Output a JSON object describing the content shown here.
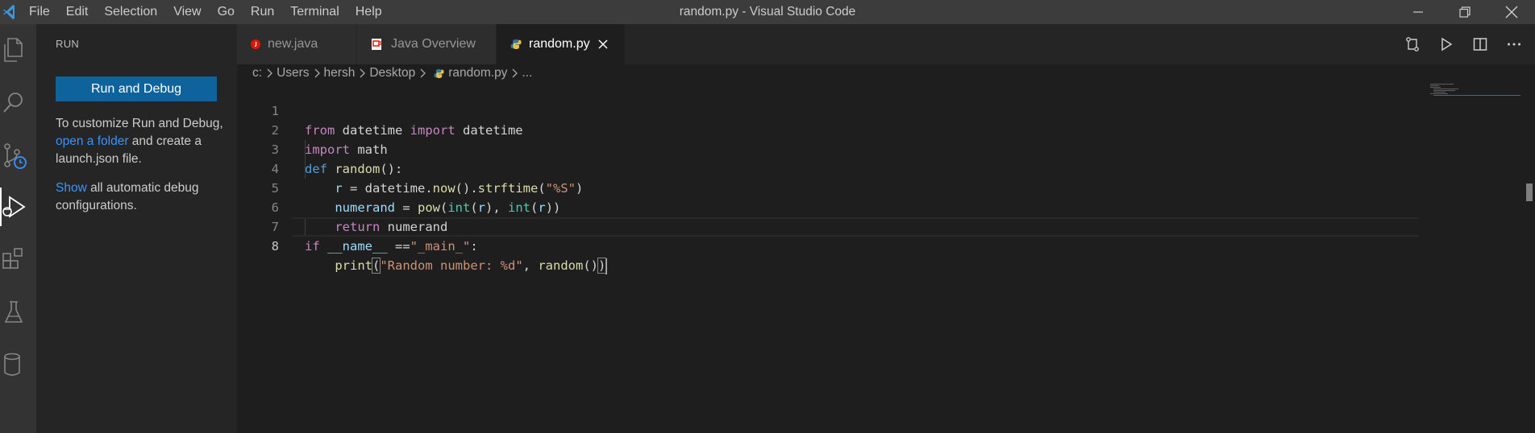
{
  "window": {
    "title": "random.py - Visual Studio Code",
    "menu": [
      "File",
      "Edit",
      "Selection",
      "View",
      "Go",
      "Run",
      "Terminal",
      "Help"
    ]
  },
  "activity_bar": {
    "items": [
      "explorer-icon",
      "search-icon",
      "source-control-icon",
      "run-debug-icon",
      "extensions-icon",
      "testing-icon",
      "database-icon"
    ],
    "active": "run-debug-icon"
  },
  "sidebar": {
    "title": "RUN",
    "run_button": "Run and Debug",
    "para1_prefix": "To customize Run and Debug, ",
    "para1_link": "open a folder",
    "para1_suffix": " and create a launch.json file.",
    "para2_link": "Show",
    "para2_suffix": " all automatic debug configurations."
  },
  "tabs": [
    {
      "label": "new.java",
      "icon": "java-error-icon",
      "active": false
    },
    {
      "label": "Java Overview",
      "icon": "java-overview-icon",
      "active": false
    },
    {
      "label": "random.py",
      "icon": "python-icon",
      "active": true
    }
  ],
  "breadcrumb": {
    "parts": [
      "c:",
      "Users",
      "hersh",
      "Desktop",
      "random.py",
      "..."
    ]
  },
  "editor": {
    "language": "python",
    "current_line": 8,
    "line_numbers": [
      "1",
      "2",
      "3",
      "4",
      "5",
      "6",
      "7",
      "8"
    ],
    "lines": [
      "from datetime import datetime",
      "import math",
      "def random():",
      "    r = datetime.now().strftime(\"%S\")",
      "    numerand = pow(int(r), int(r))",
      "    return numerand",
      "if __name__ ==\"_main_\":",
      "    print(\"Random number: %d\", random())"
    ],
    "tokens": {
      "l1": [
        "from",
        " datetime ",
        "import",
        " datetime"
      ],
      "l2": [
        "import",
        " math"
      ],
      "l3": [
        "def",
        " ",
        "random",
        "():"
      ],
      "l4": [
        "    ",
        "r",
        " = ",
        "datetime",
        ".",
        "now",
        "().",
        "strftime",
        "(",
        "\"%S\"",
        ")"
      ],
      "l5": [
        "    ",
        "numerand",
        " = ",
        "pow",
        "(",
        "int",
        "(",
        "r",
        "), ",
        "int",
        "(",
        "r",
        "))"
      ],
      "l6": [
        "    ",
        "return",
        " ",
        "numerand"
      ],
      "l7": [
        "if",
        " ",
        "__name__",
        " ==",
        "\"_main_\"",
        ":"
      ],
      "l8": [
        "    ",
        "print",
        "(",
        "\"Random number: %d\"",
        ", ",
        "random",
        "()",
        ")"
      ]
    }
  },
  "colors": {
    "accent_button": "#0e639c",
    "link": "#3794ff",
    "keyword_control": "#c586c0",
    "keyword": "#569cd6",
    "function": "#dcdcaa",
    "string": "#ce9178",
    "class": "#4ec9b0",
    "variable": "#9cdcfe"
  }
}
